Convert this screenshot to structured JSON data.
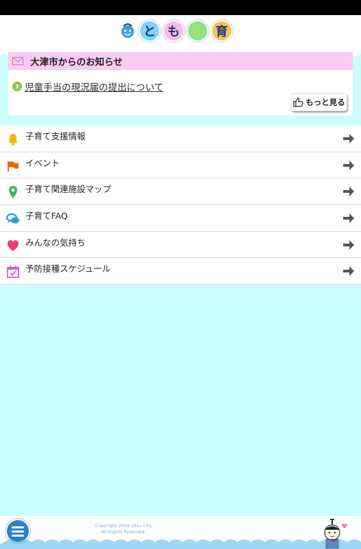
{
  "app": {
    "logo_chars": [
      "と",
      "も",
      "☆",
      "育"
    ]
  },
  "notice": {
    "title": "大津市からのお知らせ",
    "item": "児童手当の現況届の提出について",
    "more_label": "もっと見る"
  },
  "menu": [
    {
      "label": "子育て支援情報",
      "icon": "bell-icon"
    },
    {
      "label": "イベント",
      "icon": "flag-icon"
    },
    {
      "label": "子育て関連施設マップ",
      "icon": "map-pin-icon"
    },
    {
      "label": "子育てFAQ",
      "icon": "chat-bubbles-icon"
    },
    {
      "label": "みんなの気持ち",
      "icon": "heart-icon"
    },
    {
      "label": "予防接種スケジュール",
      "icon": "calendar-check-icon"
    }
  ],
  "footer": {
    "copyright_line1": "Copyright 2016 Otsu City",
    "copyright_line2": "All Rights Reserved."
  },
  "colors": {
    "background": "#ccfcff",
    "notice_header": "#fbcbf0",
    "accent_blue": "#2f7fc6",
    "arrow": "#555555"
  }
}
